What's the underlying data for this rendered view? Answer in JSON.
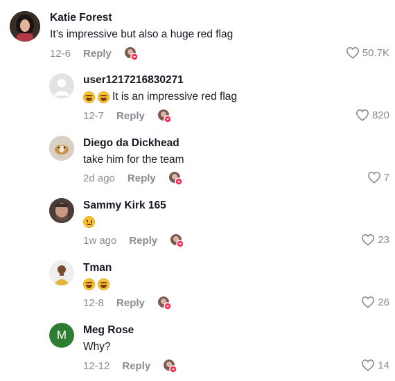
{
  "comments": [
    {
      "name": "Katie Forest",
      "text": "It’s impressive but also a huge red flag",
      "emoji": "",
      "date": "12-6",
      "reply": "Reply",
      "likes": "50.7K",
      "avatar": "photo-dark-hair",
      "liked_by_creator": true
    },
    {
      "name": "user1217216830271",
      "text": "It is an impressive red flag",
      "emoji": "laugh laugh",
      "date": "12-7",
      "reply": "Reply",
      "likes": "820",
      "avatar": "default-gray",
      "liked_by_creator": true
    },
    {
      "name": "Diego da Dickhead",
      "text": "take him for the team",
      "emoji": "",
      "date": "2d ago",
      "reply": "Reply",
      "likes": "7",
      "avatar": "photo-dog",
      "liked_by_creator": true
    },
    {
      "name": "Sammy Kirk 165",
      "text": "",
      "emoji": "wink",
      "date": "1w ago",
      "reply": "Reply",
      "likes": "23",
      "avatar": "photo-man-beard",
      "liked_by_creator": true
    },
    {
      "name": "Tman",
      "text": "",
      "emoji": "laugh laugh",
      "date": "12-8",
      "reply": "Reply",
      "likes": "26",
      "avatar": "photo-man-yellow",
      "liked_by_creator": true
    },
    {
      "name": "Meg Rose",
      "text": "Why?",
      "emoji": "",
      "date": "12-12",
      "reply": "Reply",
      "likes": "14",
      "avatar": "letter-M",
      "avatar_letter": "M",
      "avatar_color": "#2e7d32",
      "liked_by_creator": true
    }
  ],
  "colors": {
    "text": "#161823",
    "muted": "#8a8b91",
    "like_badge": "#fe2c55"
  }
}
